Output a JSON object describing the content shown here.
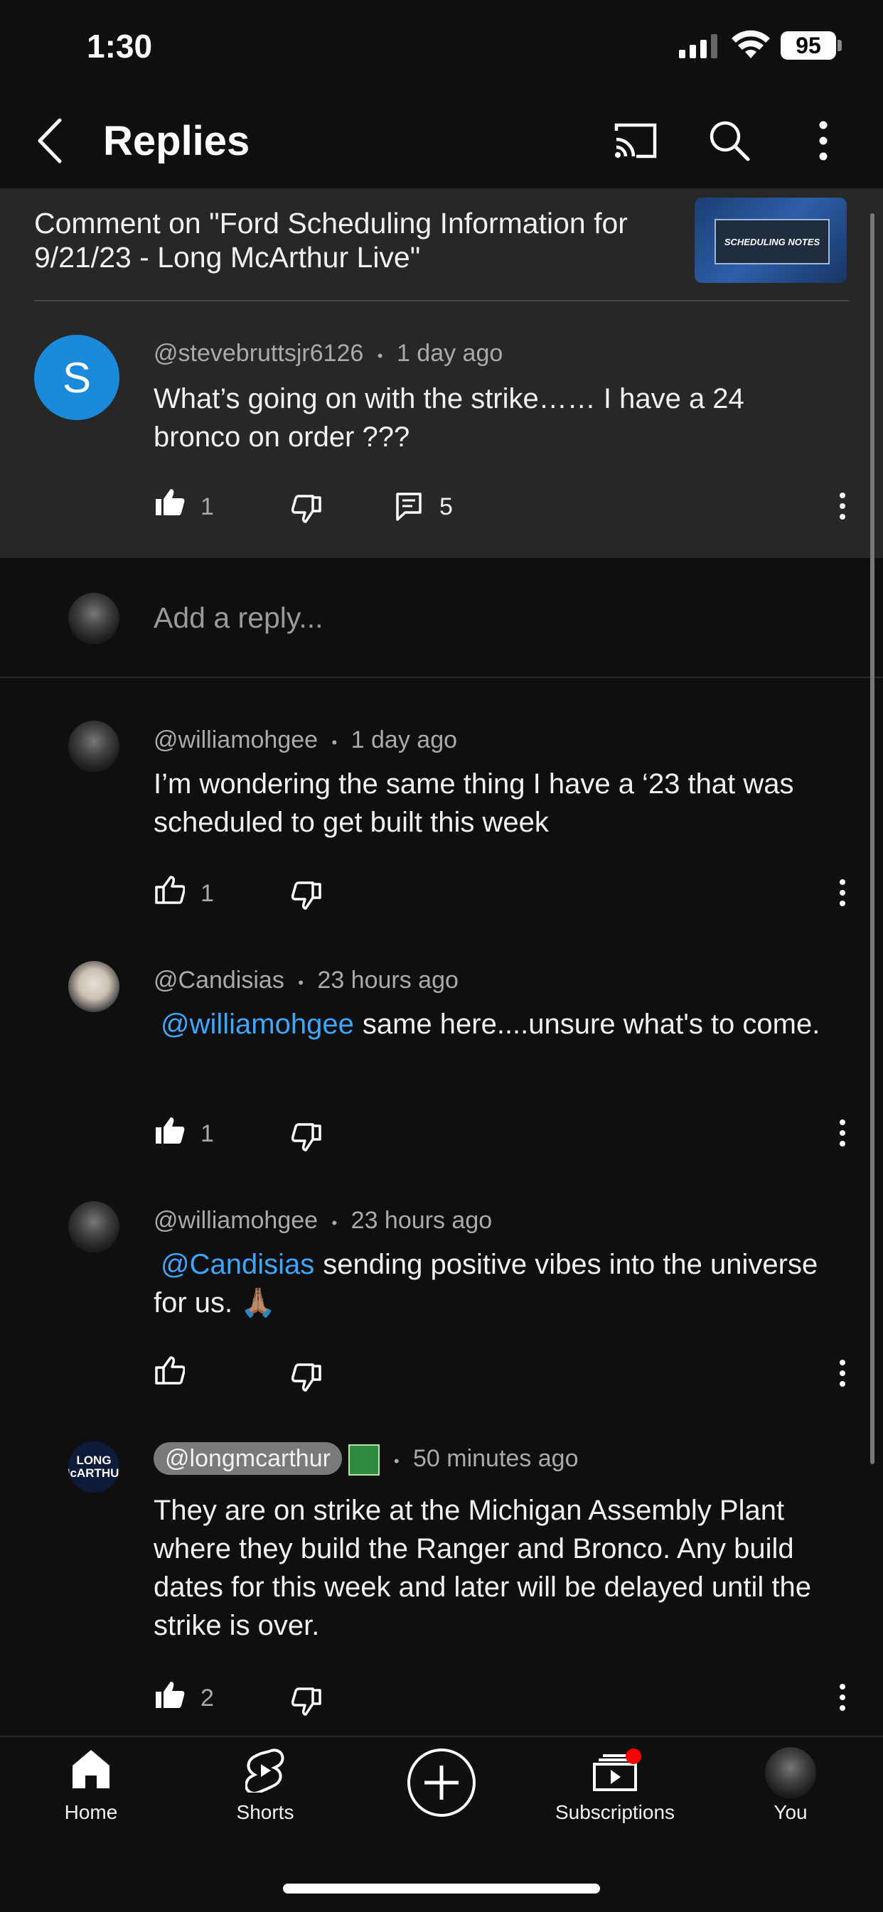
{
  "status_bar": {
    "time": "1:30",
    "battery": "95"
  },
  "header": {
    "title": "Replies"
  },
  "context": {
    "text": "Comment on \"Ford Scheduling Information for 9/21/23 - Long McArthur Live\"",
    "thumbnail_text": "SCHEDULING NOTES"
  },
  "main_comment": {
    "avatar_letter": "S",
    "author": "@stevebruttsjr6126",
    "separator": "•",
    "time": "1 day ago",
    "text": "What’s going on with the strike…… I have a 24 bronco on order ???",
    "likes": "1",
    "replies": "5"
  },
  "add_reply": {
    "placeholder": "Add a reply..."
  },
  "replies": [
    {
      "author": "@williamohgee",
      "time": "1 day ago",
      "text": "I’m wondering the same thing I have a ‘23 that was scheduled to get built this week",
      "likes": "1"
    },
    {
      "author": "@Candisias",
      "time": "23 hours ago",
      "mention": "@williamohgee",
      "text": "same here....unsure what's to come.",
      "likes": "1"
    },
    {
      "author": "@williamohgee",
      "time": "23 hours ago",
      "mention": "@Candisias",
      "text": "sending positive vibes into the universe for us. 🙏🏽",
      "likes": ""
    },
    {
      "author": "@longmcarthur",
      "time": "50 minutes ago",
      "avatar_text": "LONG McARTHUR",
      "text": "They are on strike at the Michigan Assembly Plant where they build the Ranger and Bronco. Any build dates for this week and later will be delayed until the strike is over.",
      "likes": "2"
    }
  ],
  "nav": {
    "items": [
      {
        "label": "Home"
      },
      {
        "label": "Shorts"
      },
      {
        "label": ""
      },
      {
        "label": "Subscriptions"
      },
      {
        "label": "You"
      }
    ]
  },
  "colors": {
    "accent": "#3ea6ff",
    "background": "#0f0f0f",
    "panel": "#272727",
    "avatar": "#1c8adb",
    "notification": "#ff0000"
  }
}
